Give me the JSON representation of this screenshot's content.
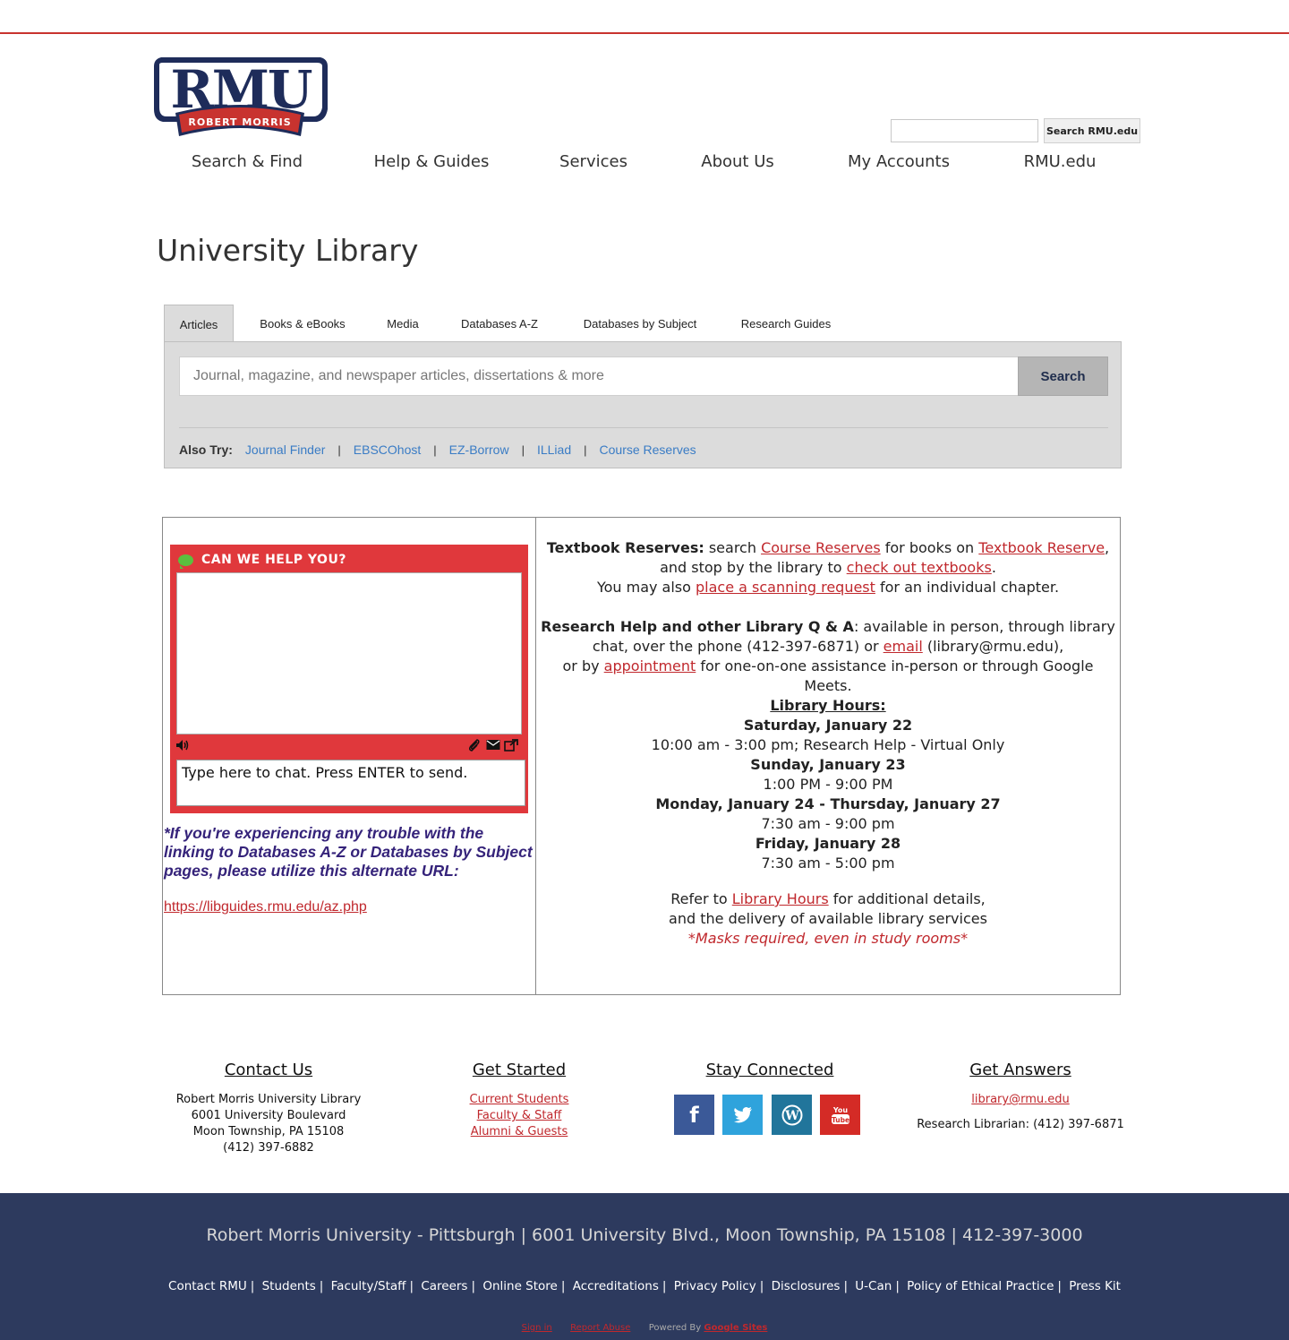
{
  "colors": {
    "brand_red": "#c8332f",
    "brand_navy": "#2d3a5e",
    "link_red": "#c0282d",
    "link_blue": "#3a7cc5",
    "panel_gray": "#dcdcdc",
    "chat_red": "#e0383c"
  },
  "logo": {
    "main_text": "RMU",
    "ribbon_text": "ROBERT MORRIS",
    "trademark": "TM"
  },
  "site_search": {
    "value": "",
    "button_label": "Search RMU.edu"
  },
  "nav": {
    "items": [
      "Search & Find",
      "Help & Guides",
      "Services",
      "About Us",
      "My Accounts",
      "RMU.edu"
    ]
  },
  "page": {
    "title": "University Library"
  },
  "search_widget": {
    "tabs": [
      "Articles",
      "Books & eBooks",
      "Media",
      "Databases A-Z",
      "Databases by Subject",
      "Research Guides"
    ],
    "active_tab": "Articles",
    "placeholder": "Journal, magazine, and newspaper articles, dissertations & more",
    "button_label": "Search",
    "also_try_label": "Also Try:",
    "also_try_links": [
      "Journal Finder",
      "EBSCOhost",
      "EZ-Borrow",
      "ILLiad",
      "Course Reserves"
    ],
    "separator": "|"
  },
  "chat": {
    "title": "CAN WE HELP YOU?",
    "input_placeholder": "Type here to chat. Press ENTER to send.",
    "icons": [
      "speaker-icon",
      "paperclip-icon",
      "envelope-icon",
      "external-link-icon"
    ]
  },
  "trouble": {
    "note": "*If you're experiencing any trouble with the linking to Databases A-Z or Databases by Subject pages, please utilize this alternate URL:",
    "url": "https://libguides.rmu.edu/az.php"
  },
  "info": {
    "textbook_label": "Textbook Reserves:",
    "textbook_t1": " search ",
    "textbook_link1": "Course Reserves",
    "textbook_t2": " for books on ",
    "textbook_link2": "Textbook Reserve",
    "textbook_t3": ", and stop by the library to ",
    "textbook_link3": "check out textbooks",
    "textbook_t4": ".",
    "scan_t1": "You may also ",
    "scan_link": "place a scanning request",
    "scan_t2": " for an individual chapter.",
    "research_label": "Research Help and other Library Q & A",
    "research_t1": ": available in person, through library chat, over the phone (412-397-6871) or ",
    "research_email_link": "email",
    "research_t2": " (library@rmu.edu),",
    "research_t3": "or by ",
    "research_appt_link": "appointment",
    "research_t4": " for one-on-one assistance in-person or through Google Meets.",
    "hours_title": "Library Hours: ",
    "hours": [
      {
        "day": "Saturday, January  22",
        "time": "10:00 am - 3:00 pm; Research Help - Virtual Only"
      },
      {
        "day": "Sunday, January 23",
        "time": "1:00 PM - 9:00 PM"
      },
      {
        "day": "Monday, January 24 - Thursday, January 27",
        "time": "7:30 am - 9:00 pm"
      },
      {
        "day": "Friday, January 28",
        "time": "7:30 am - 5:00 pm"
      }
    ],
    "refer_t1": "Refer to ",
    "refer_link": "Library Hours",
    "refer_t2": " for additional details,",
    "refer_t3": "and the delivery of available library services",
    "masks": "*Masks required, even in study rooms*"
  },
  "footer": {
    "contact": {
      "title": "Contact Us",
      "lines": [
        "Robert Morris University Library",
        "6001 University Boulevard",
        "Moon Township, PA 15108",
        "(412) 397-6882"
      ]
    },
    "get_started": {
      "title": "Get Started",
      "links": [
        "Current Students",
        "Faculty & Staff",
        "Alumni & Guests"
      ]
    },
    "stay_connected": {
      "title": "Stay Connected",
      "icons": [
        {
          "name": "facebook-icon",
          "glyph": "f",
          "color": "#3b5998"
        },
        {
          "name": "twitter-icon",
          "glyph": "t",
          "color": "#2fa3dc"
        },
        {
          "name": "wordpress-icon",
          "glyph": "W",
          "color": "#21759b"
        },
        {
          "name": "youtube-icon",
          "glyph": "You Tube",
          "color": "#d42b26"
        }
      ]
    },
    "get_answers": {
      "title": "Get Answers",
      "email": "library@rmu.edu",
      "phone": "Research Librarian: (412) 397-6871"
    }
  },
  "bottom": {
    "address": "Robert Morris University - Pittsburgh | 6001 University Blvd., Moon Township, PA 15108 | 412-397-3000",
    "links": [
      "Contact RMU",
      "Students",
      "Faculty/Staff",
      "Careers",
      "Online Store",
      "Accreditations",
      "Privacy Policy",
      "Disclosures",
      "U-Can",
      "Policy of Ethical Practice",
      "Press Kit"
    ],
    "sign_in": "Sign in",
    "report_abuse": "Report Abuse",
    "powered_by": "Powered By",
    "google_sites": "Google Sites"
  }
}
